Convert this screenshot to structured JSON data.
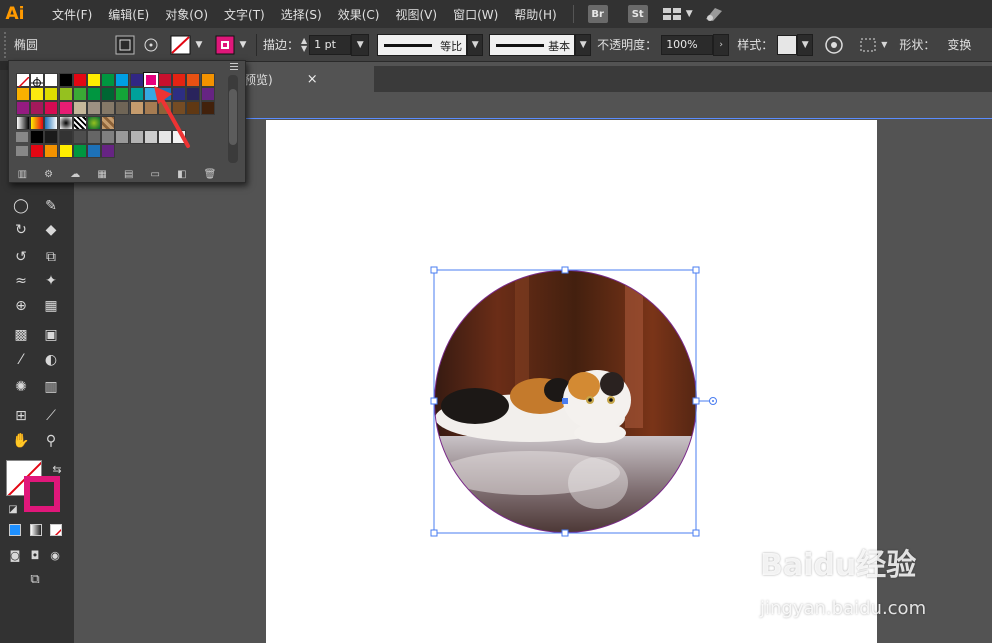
{
  "menubar": {
    "logo": "Ai",
    "items": [
      "文件(F)",
      "编辑(E)",
      "对象(O)",
      "文字(T)",
      "选择(S)",
      "效果(C)",
      "视图(V)",
      "窗口(W)",
      "帮助(H)"
    ],
    "badges": [
      "Br",
      "St"
    ]
  },
  "control": {
    "object_label": "椭圆",
    "stroke_label": "描边：",
    "stroke_weight": "1 pt",
    "profile_label": "等比",
    "brush_label": "基本",
    "opacity_label": "不透明度：",
    "opacity_value": "100%",
    "style_label": "样式：",
    "shape_label": "形状：",
    "transform_label": "变换"
  },
  "document": {
    "tab_title": "预览)",
    "close_glyph": "×"
  },
  "swatches": {
    "rows": [
      [
        "#ffffff",
        "#ffffff",
        "#ffffff",
        "#000000",
        "#e30613",
        "#ffed00",
        "#009640",
        "#009fe3",
        "#312783",
        "#e6007e",
        "#c8102e",
        "#e42313",
        "#e85113",
        "#f39200"
      ],
      [
        "#f9b000",
        "#fcea10",
        "#dedc00",
        "#95c11f",
        "#3aaa35",
        "#009640",
        "#006633",
        "#13a538",
        "#00a19a",
        "#36a9e1",
        "#1d71b8",
        "#2d2e83",
        "#29235c",
        "#662483"
      ],
      [
        "#951b81",
        "#a3195b",
        "#d60b52",
        "#e71d73",
        "#c5b79a",
        "#9d9082",
        "#857968",
        "#6f6556",
        "#c69c6d",
        "#a67c52",
        "#8c6239",
        "#754c24",
        "#603813",
        "#42210b"
      ]
    ],
    "gray_row": [
      "#000000",
      "#1a1a1a",
      "#333333",
      "#4d4d4d",
      "#666666",
      "#808080",
      "#999999",
      "#b3b3b3",
      "#cccccc",
      "#e6e6e6",
      "#f2f2f2"
    ],
    "color_row": [
      "#e30613",
      "#f39200",
      "#ffed00",
      "#009640",
      "#1d71b8",
      "#662483"
    ]
  },
  "watermark": {
    "main": "Baidu经验",
    "sub": "jingyan.baidu.com"
  },
  "colors": {
    "accent_stroke": "#e0177a",
    "selection": "#4a7df0",
    "arrow": "#ee3333"
  }
}
